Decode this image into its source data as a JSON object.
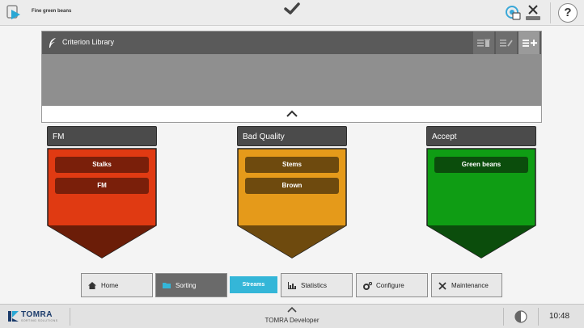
{
  "topbar": {
    "program_name": "Fine green beans",
    "icons": [
      "play-icon",
      "checkmark-icon",
      "connection-icon",
      "remote-disconnect-icon",
      "help-icon"
    ],
    "help_label": "?"
  },
  "library": {
    "title": "Criterion Library",
    "tools": [
      "list-delete-icon",
      "list-edit-icon",
      "list-add-icon"
    ],
    "expand_icon": "chevron-up-icon"
  },
  "columns": [
    {
      "title": "FM",
      "color": "#e03a12",
      "tip_color": "#6b1d08",
      "chip_color": "#7a1f0a",
      "criteria": [
        "Stalks",
        "FM"
      ]
    },
    {
      "title": "Bad Quality",
      "color": "#e59a1a",
      "tip_color": "#6e4a0e",
      "chip_color": "#6e4a0e",
      "criteria": [
        "Stems",
        "Brown"
      ]
    },
    {
      "title": "Accept",
      "color": "#0f9d14",
      "tip_color": "#0b4d0c",
      "chip_color": "#0b4d0c",
      "criteria": [
        "Green beans"
      ]
    }
  ],
  "tabs": {
    "home": "Home",
    "sorting": "Sorting",
    "streams": "Streams",
    "statistics": "Statistics",
    "configure": "Configure",
    "maintenance": "Maintenance"
  },
  "status": {
    "brand": "TOMRA",
    "brand_sub": "SORTING SOLUTIONS",
    "user": "TOMRA Developer",
    "time": "10:48"
  },
  "colors": {
    "accent": "#34b6d8",
    "header_dark": "#4b4b4b"
  }
}
